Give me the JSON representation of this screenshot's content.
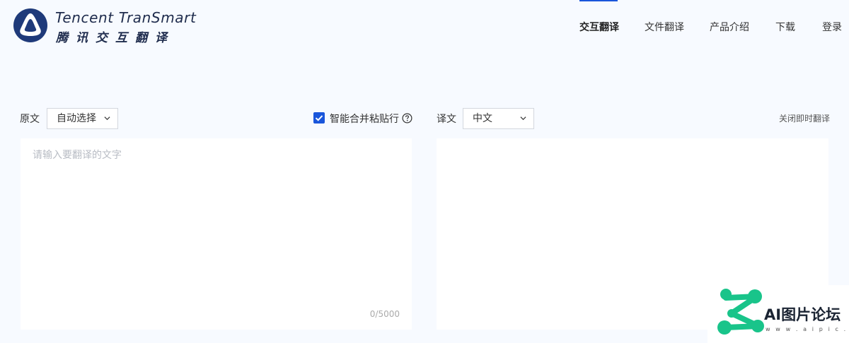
{
  "header": {
    "brand_en": "Tencent TranSmart",
    "brand_cn": "腾讯交互翻译",
    "nav": [
      {
        "label": "交互翻译",
        "active": true
      },
      {
        "label": "文件翻译",
        "active": false
      },
      {
        "label": "产品介绍",
        "active": false
      },
      {
        "label": "下载",
        "active": false
      },
      {
        "label": "登录",
        "active": false
      }
    ]
  },
  "source": {
    "label": "原文",
    "language": "自动选择",
    "smart_merge": {
      "label": "智能合并粘贴行",
      "checked": true
    },
    "placeholder": "请输入要翻译的文字",
    "char_count": "0/5000"
  },
  "target": {
    "label": "译文",
    "language": "中文",
    "close_instant": "关闭即时翻译"
  },
  "watermark": {
    "text": "AI图片论坛",
    "url": "w w w . a i p i c . c c"
  },
  "colors": {
    "accent": "#1a56db",
    "brand_dark": "#1f2c4d",
    "watermark_green": "#19c48a"
  }
}
